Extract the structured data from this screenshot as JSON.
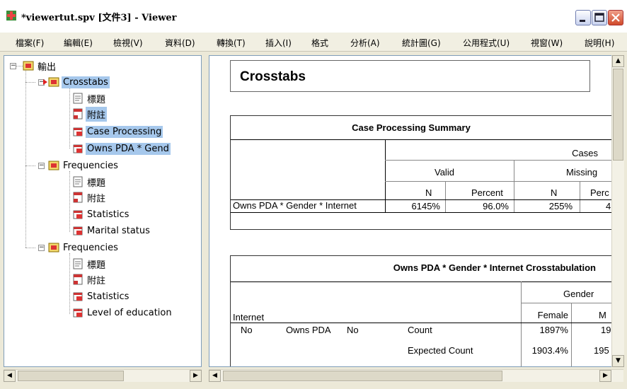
{
  "window": {
    "title": "*viewertut.spv [文件3] - Viewer"
  },
  "menu": [
    "檔案(F)",
    "編輯(E)",
    "檢視(V)",
    "資料(D)",
    "轉換(T)",
    "插入(I)",
    "格式",
    "分析(A)",
    "統計圖(G)",
    "公用程式(U)",
    "視窗(W)",
    "說明(H)"
  ],
  "outline": {
    "root": "輸出",
    "crosstabs": {
      "label": "Crosstabs",
      "children": [
        "標題",
        "附註",
        "Case Processing",
        "Owns PDA * Gend"
      ]
    },
    "frequencies1": {
      "label": "Frequencies",
      "children": [
        "標題",
        "附註",
        "Statistics",
        "Marital status"
      ]
    },
    "frequencies2": {
      "label": "Frequencies",
      "children": [
        "標題",
        "附註",
        "Statistics",
        "Level of education"
      ]
    }
  },
  "content": {
    "heading": "Crosstabs",
    "case_summary": {
      "title": "Case Processing Summary",
      "cases": "Cases",
      "valid": "Valid",
      "missing": "Missing",
      "col_n": "N",
      "col_percent": "Percent",
      "col_n2": "N",
      "col_percent2": "Perc",
      "row_label": "Owns PDA * Gender * Internet",
      "row_valid_n": "6145%",
      "row_valid_pct": "96.0%",
      "row_missing_n": "255%",
      "row_missing_pct": "4"
    },
    "crosstab": {
      "title": "Owns PDA * Gender * Internet Crosstabulation",
      "gender": "Gender",
      "internet": "Internet",
      "female": "Female",
      "male": "M",
      "r_internet": "No",
      "r_owns": "Owns PDA",
      "r_owns_val": "No",
      "stat1": "Count",
      "stat1_female": "1897%",
      "stat1_male": "19",
      "stat2": "Expected Count",
      "stat2_female": "1903.4%",
      "stat2_male": "195"
    }
  },
  "colors": {
    "selection": "#a6c8ec",
    "close_button": "#d04a2a"
  }
}
